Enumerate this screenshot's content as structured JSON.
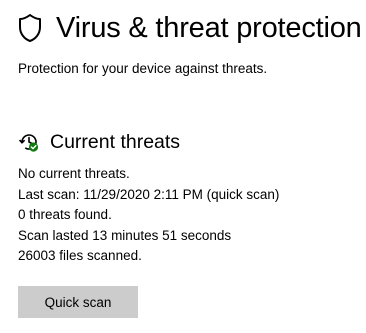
{
  "header": {
    "icon": "shield-icon",
    "title": "Virus & threat protection",
    "subtitle": "Protection for your device against threats."
  },
  "current_threats": {
    "icon": "threat-history-icon",
    "heading": "Current threats",
    "status": "No current threats.",
    "last_scan": "Last scan: 11/29/2020 2:11 PM (quick scan)",
    "threats_found": "0 threats found.",
    "scan_duration": "Scan lasted 13 minutes 51 seconds",
    "files_scanned": "26003 files scanned.",
    "quick_scan_label": "Quick scan"
  },
  "colors": {
    "background": "#ffffff",
    "text": "#000000",
    "button_background": "#cccccc",
    "status_check": "#107c10"
  }
}
